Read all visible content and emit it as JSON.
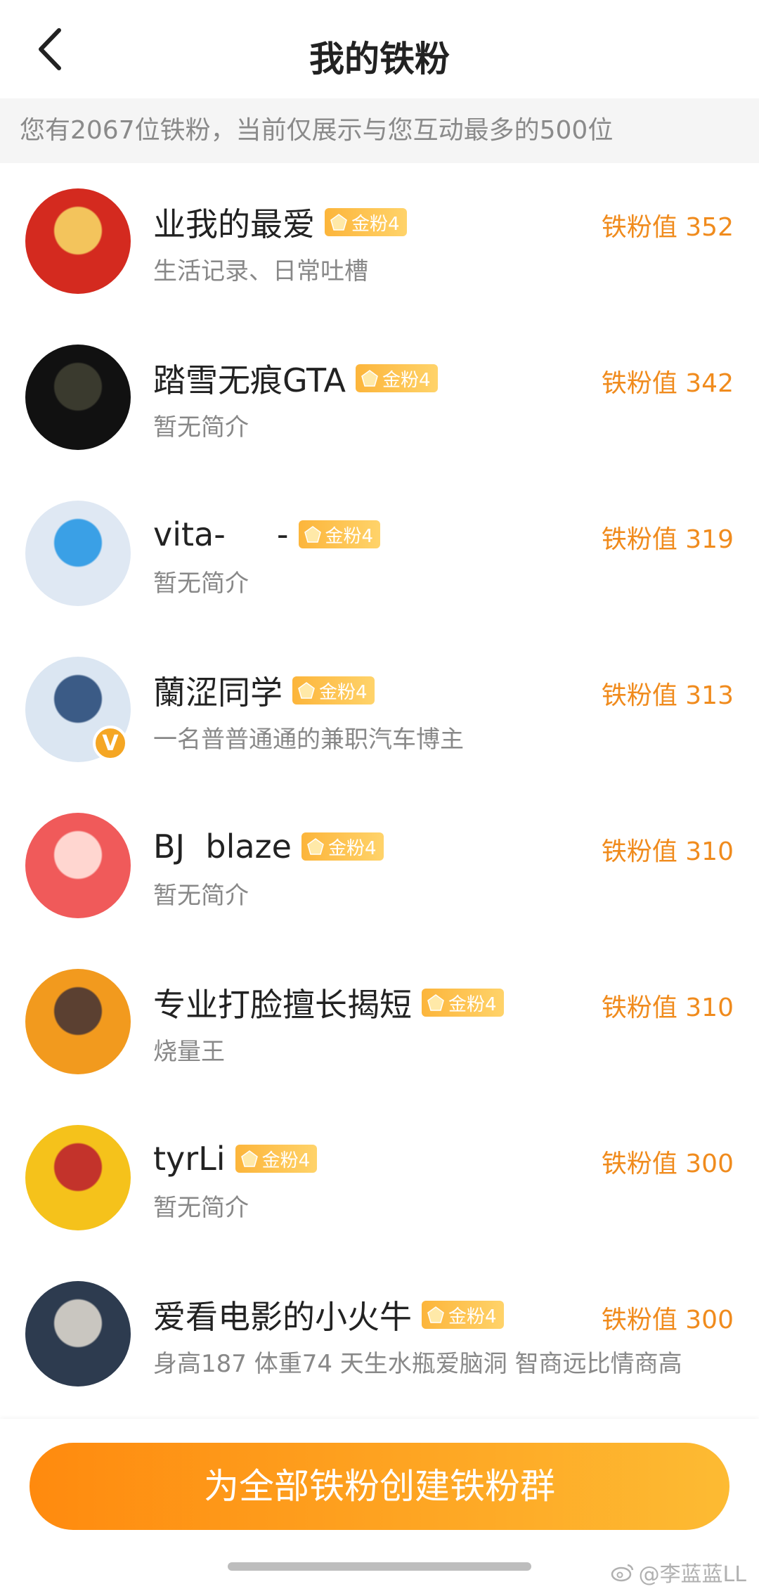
{
  "header": {
    "title": "我的铁粉"
  },
  "notice": "您有2067位铁粉，当前仅展示与您互动最多的500位",
  "fans": [
    {
      "name": "业我的最爱",
      "badge": "金粉4",
      "bio": "生活记录、日常吐槽",
      "score": "铁粉值 352",
      "avatar_colors": [
        "#d42a1f",
        "#f3c45c"
      ],
      "verified": false
    },
    {
      "name": "踏雪无痕GTA",
      "badge": "金粉4",
      "bio": "暂无简介",
      "score": "铁粉值 342",
      "avatar_colors": [
        "#111111",
        "#3a3a2e"
      ],
      "verified": false
    },
    {
      "name": "vita-     -",
      "badge": "金粉4",
      "bio": "暂无简介",
      "score": "铁粉值 319",
      "avatar_colors": [
        "#dfe8f3",
        "#3aa0e6"
      ],
      "verified": false
    },
    {
      "name": "蘭涩同学",
      "badge": "金粉4",
      "bio": "一名普普通通的兼职汽车博主",
      "score": "铁粉值 313",
      "avatar_colors": [
        "#dbe6f2",
        "#3b5b86"
      ],
      "verified": true,
      "verified_mark": "V"
    },
    {
      "name": "BJ  blaze",
      "badge": "金粉4",
      "bio": "暂无简介",
      "score": "铁粉值 310",
      "avatar_colors": [
        "#f05a5a",
        "#ffd6d0"
      ],
      "verified": false
    },
    {
      "name": "专业打脸擅长揭短",
      "badge": "金粉4",
      "bio": "烧量王",
      "score": "铁粉值 310",
      "avatar_colors": [
        "#f29a1e",
        "#5b4031"
      ],
      "verified": false
    },
    {
      "name": "tyrLi",
      "badge": "金粉4",
      "bio": "暂无简介",
      "score": "铁粉值 300",
      "avatar_colors": [
        "#f5c21b",
        "#c3332b"
      ],
      "verified": false
    },
    {
      "name": "爱看电影的小火牛",
      "badge": "金粉4",
      "bio": "身高187 体重74 天生水瓶爱脑洞 智商远比情商高",
      "score": "铁粉值 300",
      "avatar_colors": [
        "#2d3b4f",
        "#c9c6c0"
      ],
      "verified": false
    }
  ],
  "create_button": "为全部铁粉创建铁粉群",
  "watermark": "@李蓝蓝LL",
  "colors": {
    "accent": "#f08b1d",
    "badge": "#fcb53b"
  },
  "icons": {
    "back": "chevron-left-icon",
    "badge": "gem-icon",
    "watermark": "weibo-icon"
  }
}
